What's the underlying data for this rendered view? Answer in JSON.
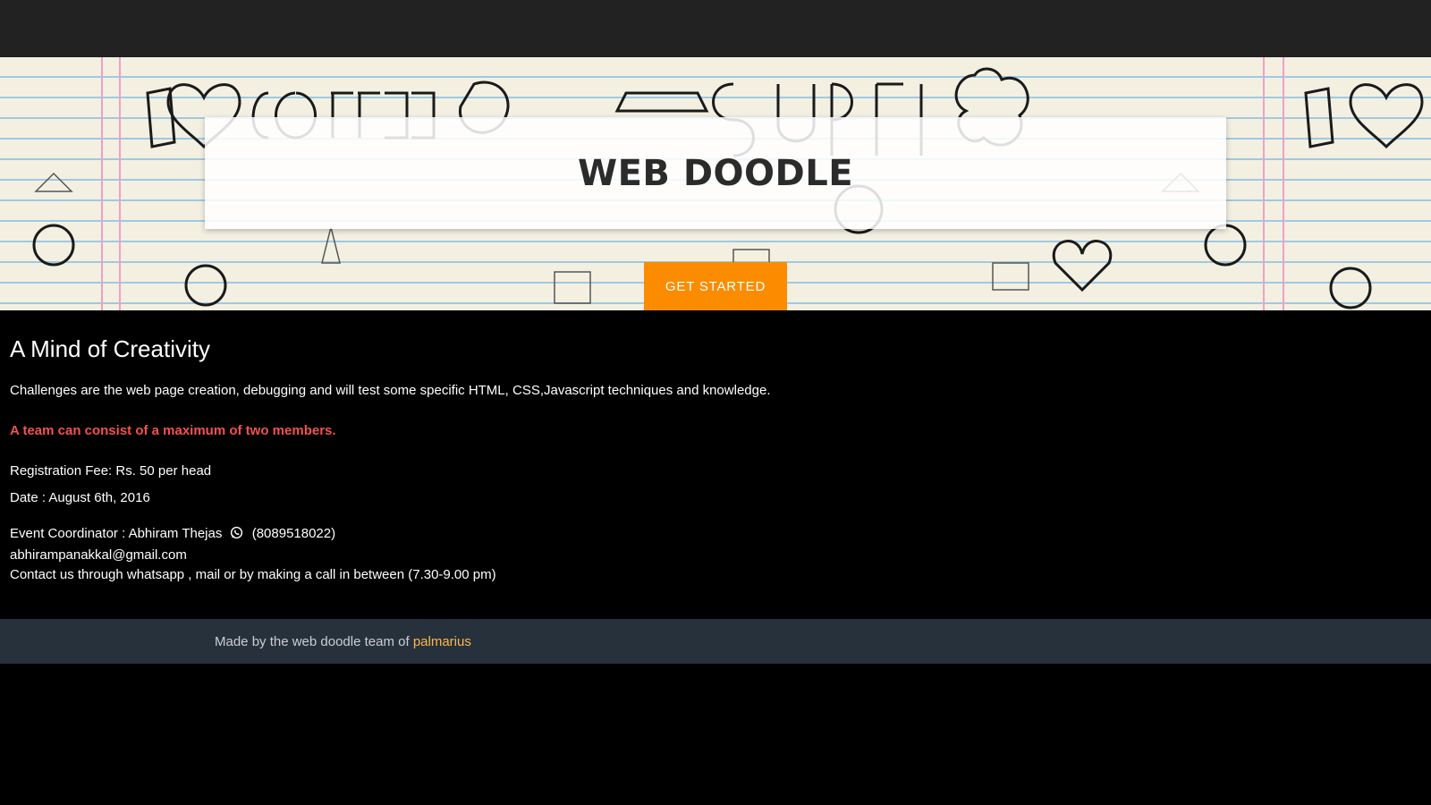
{
  "hero": {
    "title": "WEB DOODLE",
    "cta_label": "GET STARTED"
  },
  "content": {
    "heading": "A Mind of Creativity",
    "challenges": "Challenges are the web page creation, debugging and will test some specific HTML, CSS,Javascript techniques and knowledge.",
    "team_note": "A team can consist of a maximum of two members.",
    "fee": "Registration Fee: Rs. 50 per head",
    "date": "Date : August 6th, 2016",
    "coordinator_prefix": "Event Coordinator : Abhiram Thejas",
    "coordinator_icon": "whatsapp-icon",
    "coordinator_phone": "(8089518022)",
    "email": "abhirampanakkal@gmail.com",
    "contact": "Contact us through whatsapp , mail or by making a call in between (7.30-9.00 pm)"
  },
  "footer": {
    "text": "Made by the web doodle team of",
    "link_label": "palmarius"
  },
  "colors": {
    "topbar": "#222222",
    "cta": "#fb8c00",
    "team_note": "#ef5350",
    "footer_bg": "#27313b",
    "footer_link": "#ffb74d"
  }
}
